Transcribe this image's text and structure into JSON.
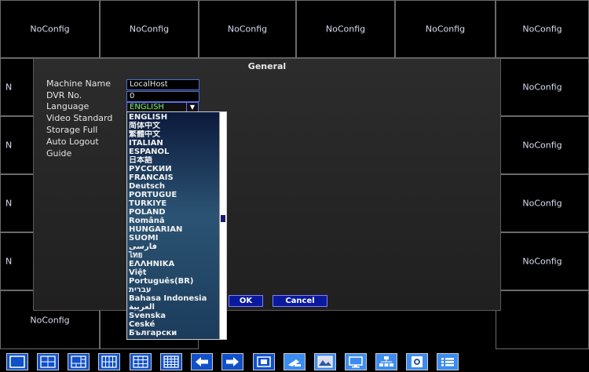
{
  "grid": {
    "cells": [
      "NoConfig",
      "NoConfig",
      "NoConfig",
      "NoConfig",
      "NoConfig",
      "NoConfig",
      "NoConfig",
      "NoConfig",
      "NoConfig",
      "NoConfig",
      "NoConfig",
      "NoConfig"
    ]
  },
  "dialog": {
    "title": "General",
    "labels": {
      "machine_name": "Machine Name",
      "dvr_no": "DVR No.",
      "language": "Language",
      "video_standard": "Video Standard",
      "storage_full": "Storage Full",
      "auto_logout": "Auto Logout",
      "guide": "Guide"
    },
    "values": {
      "machine_name": "LocalHost",
      "dvr_no": "0",
      "language": "ENGLISH"
    },
    "ok_label": "OK",
    "cancel_label": "Cancel"
  },
  "language_options": [
    "ENGLISH",
    "简体中文",
    "繁體中文",
    "ITALIAN",
    "ESPAÑOL",
    "日本語",
    "РУССКИЙ",
    "FRANCAIS",
    "Deutsch",
    "PORTUGUÊ",
    "TÜRKIYE",
    "POLAND",
    "Română",
    "HUNGARIAN",
    "SUOMI",
    "فارسی",
    "ไทย",
    "ΕΛΛΗΝΙΚΑ",
    "Việt",
    "Português(BR)",
    "עברית",
    "Bahasa Indonesia",
    "العربية",
    "Svenska",
    "České",
    "Български"
  ],
  "toolbar": {
    "icons": [
      "layout-1-icon",
      "layout-4-icon",
      "layout-6-icon",
      "layout-8-icon",
      "layout-9-icon",
      "layout-16-icon",
      "prev-icon",
      "next-icon",
      "fullscreen-icon",
      "ptz-icon",
      "image-settings-icon",
      "playback-icon",
      "network-icon",
      "record-icon",
      "menu-icon"
    ]
  },
  "colors": {
    "accent": "#1050c8",
    "selected_language": "#6ff36f",
    "button": "#0a1a9e"
  }
}
